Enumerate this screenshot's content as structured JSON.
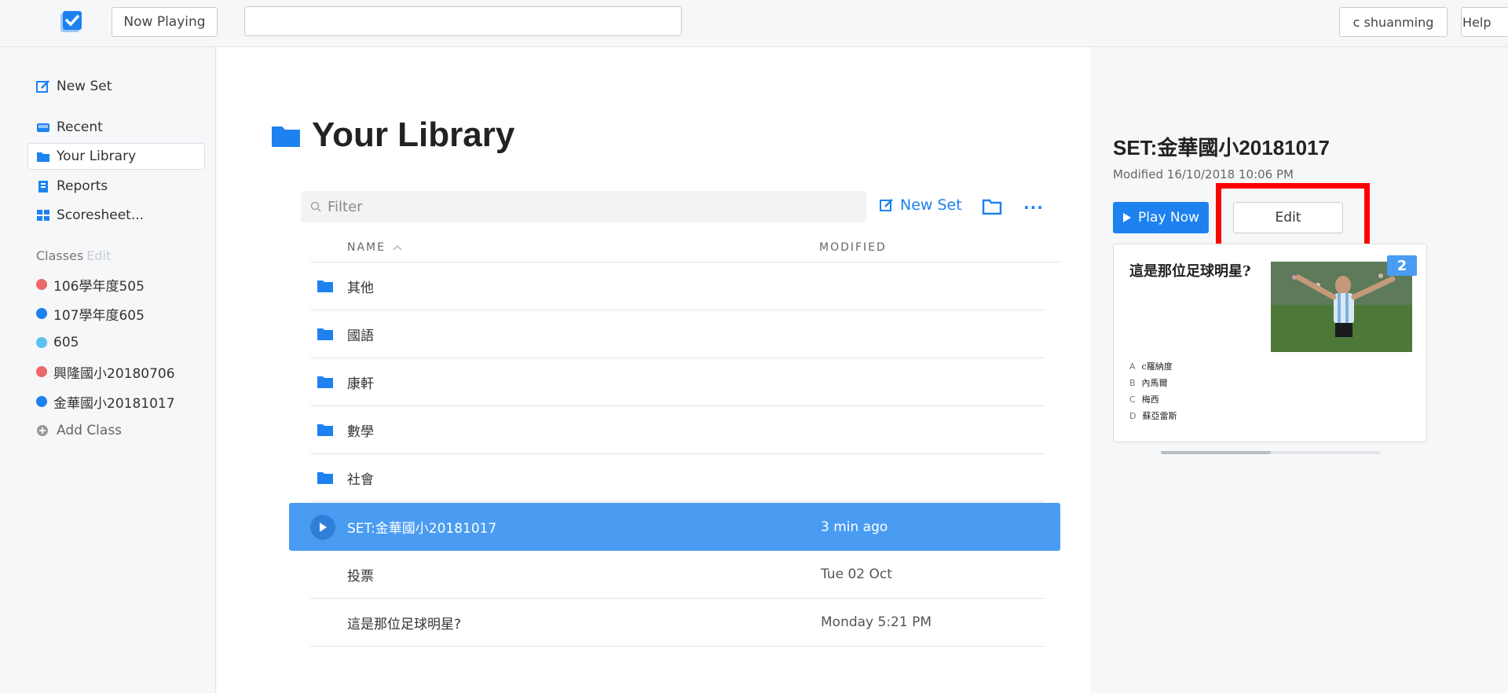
{
  "topbar": {
    "now_playing": "Now Playing",
    "search_value": "",
    "user": "c shuanming",
    "help": "Help"
  },
  "sidebar": {
    "items": [
      {
        "label": "New Set",
        "icon": "edit-icon"
      },
      {
        "label": "Recent",
        "icon": "recent-icon"
      },
      {
        "label": "Your Library",
        "icon": "folder-icon",
        "active": true
      },
      {
        "label": "Reports",
        "icon": "reports-icon"
      },
      {
        "label": "Scoresheet...",
        "icon": "scoresheet-icon"
      }
    ],
    "classes_header": "Classes",
    "classes_edit": "Edit",
    "classes": [
      {
        "label": "106學年度505",
        "color": "#ec6a6a"
      },
      {
        "label": "107學年度605",
        "color": "#1d82f0"
      },
      {
        "label": "605",
        "color": "#5bc3f2"
      },
      {
        "label": "興隆國小20180706",
        "color": "#ec6a6a"
      },
      {
        "label": "金華國小20181017",
        "color": "#1d82f0"
      }
    ],
    "add_class": "Add Class"
  },
  "library": {
    "title": "Your Library",
    "filter_placeholder": "Filter",
    "new_set": "New Set",
    "col_name": "NAME",
    "col_modified": "MODIFIED",
    "rows": [
      {
        "type": "folder",
        "name": "其他",
        "modified": ""
      },
      {
        "type": "folder",
        "name": "國語",
        "modified": ""
      },
      {
        "type": "folder",
        "name": "康軒",
        "modified": ""
      },
      {
        "type": "folder",
        "name": "數學",
        "modified": ""
      },
      {
        "type": "folder",
        "name": "社會",
        "modified": ""
      },
      {
        "type": "set",
        "name": "SET:金華國小20181017",
        "modified": "3 min ago",
        "selected": true
      },
      {
        "type": "set",
        "name": "投票",
        "modified": "Tue 02 Oct"
      },
      {
        "type": "set",
        "name": "這是那位足球明星?",
        "modified": "Monday 5:21 PM"
      }
    ]
  },
  "detail": {
    "title": "SET:金華國小20181017",
    "modified": "Modified 16/10/2018 10:06 PM",
    "play_now": "Play Now",
    "edit": "Edit",
    "card": {
      "question": "這是那位足球明星?",
      "badge": "2",
      "answers": [
        {
          "label": "A",
          "text": "c羅納度"
        },
        {
          "label": "B",
          "text": "內馬爾"
        },
        {
          "label": "C",
          "text": "梅西"
        },
        {
          "label": "D",
          "text": "蘇亞雷斯"
        }
      ]
    }
  },
  "colors": {
    "accent": "#1d82f0",
    "selected_row": "#4a9cf2",
    "highlight_box": "#ff0000"
  }
}
